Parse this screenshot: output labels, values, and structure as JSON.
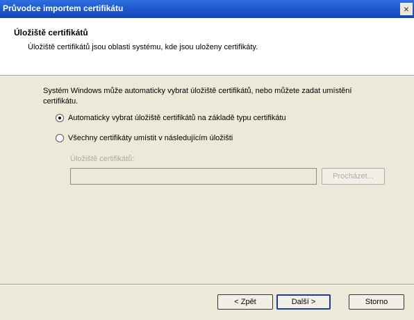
{
  "window": {
    "title": "Průvodce importem certifikátu",
    "close_glyph": "×"
  },
  "header": {
    "title": "Úložiště certifikátů",
    "description": "Úložiště certifikátů jsou oblasti systému, kde jsou uloženy certifikáty."
  },
  "body": {
    "intro": "Systém Windows může automaticky vybrat úložiště certifikátů, nebo můžete zadat umístění certifikátu.",
    "option_auto": "Automaticky vybrat úložiště certifikátů na základě typu certifikátu",
    "option_manual": "Všechny certifikáty umístit v následujícím úložišti",
    "selected_option": "auto",
    "store_label": "Úložiště certifikátů:",
    "store_value": "",
    "browse_label": "Procházet..."
  },
  "footer": {
    "back_label": "< Zpět",
    "next_label": "Další >",
    "cancel_label": "Storno"
  }
}
